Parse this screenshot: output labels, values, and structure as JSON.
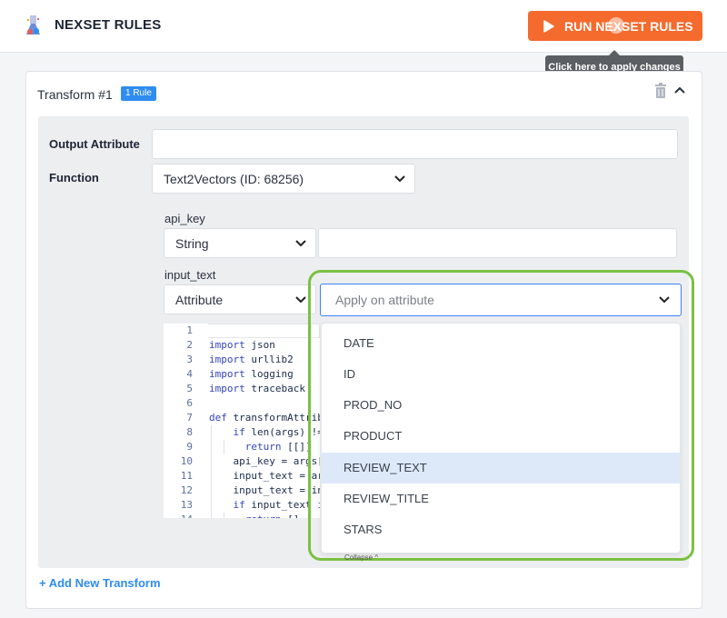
{
  "header": {
    "title": "NEXSET RULES",
    "run_button_label": "RUN NEXSET RULES",
    "tooltip": "Click here to apply changes",
    "accent_color": "#f56a2d"
  },
  "transform": {
    "title": "Transform #1",
    "badge": "1 Rule",
    "icons": [
      "trash-icon",
      "chevron-up-icon"
    ]
  },
  "form": {
    "output_attribute_label": "Output Attribute",
    "output_attribute_value": "",
    "function_label": "Function",
    "function_value": "Text2Vectors (ID: 68256)",
    "api_key": {
      "label": "api_key",
      "type_value": "String",
      "value": ""
    },
    "input_text": {
      "label": "input_text",
      "type_value": "Attribute",
      "attribute_placeholder": "Apply on attribute"
    }
  },
  "code": {
    "lines": [
      {
        "n": "1",
        "t": ""
      },
      {
        "n": "2",
        "t": "import json"
      },
      {
        "n": "3",
        "t": "import urllib2"
      },
      {
        "n": "4",
        "t": "import logging"
      },
      {
        "n": "5",
        "t": "import traceback"
      },
      {
        "n": "6",
        "t": ""
      },
      {
        "n": "7",
        "t": "def transformAttribu"
      },
      {
        "n": "8",
        "t": "    if len(args) !="
      },
      {
        "n": "9",
        "t": "      return [[]]"
      },
      {
        "n": "10",
        "t": "    api_key = args["
      },
      {
        "n": "11",
        "t": "    input_text = arg"
      },
      {
        "n": "12",
        "t": "    input_text = inp"
      },
      {
        "n": "13",
        "t": "    if input_text is"
      },
      {
        "n": "14",
        "t": "      return []"
      }
    ]
  },
  "dropdown": {
    "options": [
      "DATE",
      "ID",
      "PROD_NO",
      "PRODUCT",
      "REVIEW_TEXT",
      "REVIEW_TITLE",
      "STARS"
    ],
    "highlighted": "REVIEW_TEXT",
    "collapse_label": "Collapse ^"
  },
  "footer": {
    "add_transform_label": "+ Add New Transform"
  },
  "colors": {
    "highlight_ring": "#7ac142",
    "link": "#2f8cf0",
    "selected_option_bg": "#dde9f9"
  }
}
